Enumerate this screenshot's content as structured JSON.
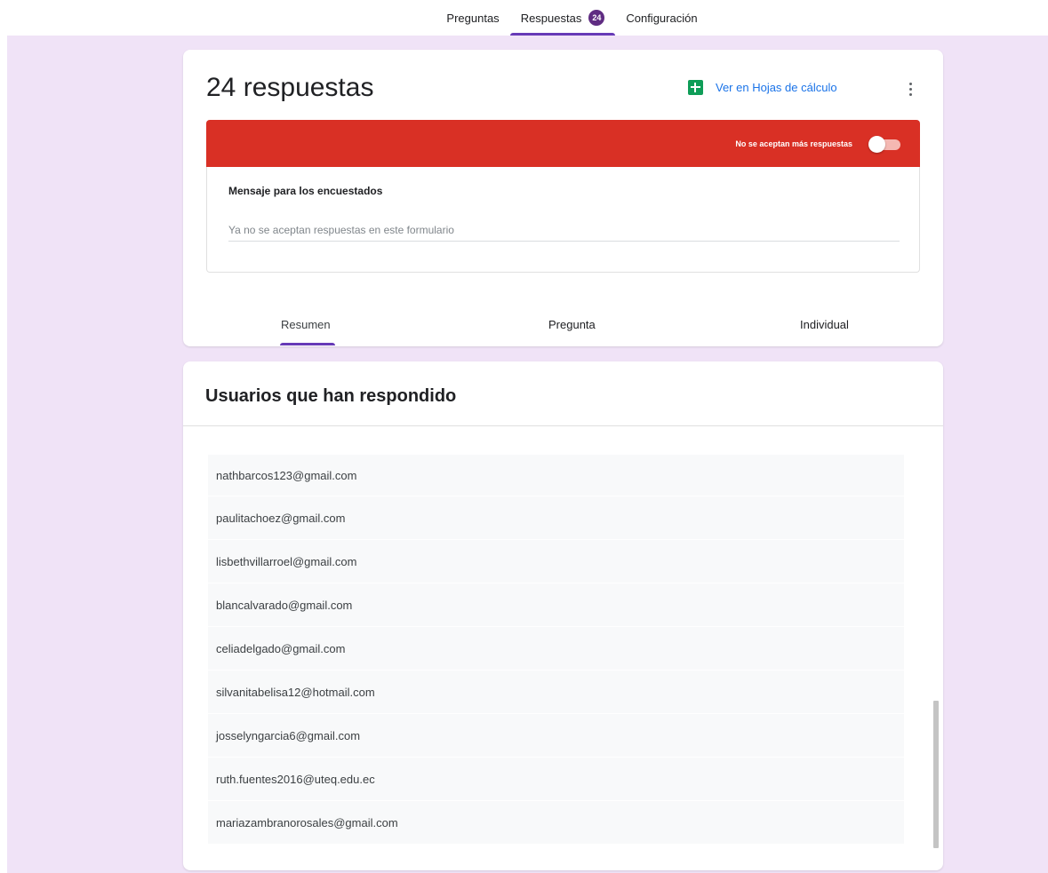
{
  "top_tabs": {
    "questions": "Preguntas",
    "responses": "Respuestas",
    "responses_count": "24",
    "settings": "Configuración"
  },
  "summary_card": {
    "title": "24 respuestas",
    "sheets_link": "Ver en Hojas de cálculo",
    "banner_status": "No se aceptan más respuestas",
    "accepting_responses": false,
    "message_label": "Mensaje para los encuestados",
    "message_value": "Ya no se aceptan respuestas en este formulario"
  },
  "sub_tabs": {
    "summary": "Resumen",
    "question": "Pregunta",
    "individual": "Individual",
    "active": "summary"
  },
  "respondents": {
    "title": "Usuarios que han respondido",
    "emails": [
      "nathbarcos123@gmail.com",
      "paulitachoez@gmail.com",
      "lisbethvillarroel@gmail.com",
      "blancalvarado@gmail.com",
      "celiadelgado@gmail.com",
      "silvanitabelisa12@hotmail.com",
      "josselyngarcia6@gmail.com",
      "ruth.fuentes2016@uteq.edu.ec",
      "mariazambranorosales@gmail.com"
    ]
  },
  "colors": {
    "accent": "#673ab7",
    "banner": "#d93025",
    "backdrop": "#f0e3f7",
    "sheets_green": "#0f9d58",
    "link_blue": "#1a73e8"
  }
}
